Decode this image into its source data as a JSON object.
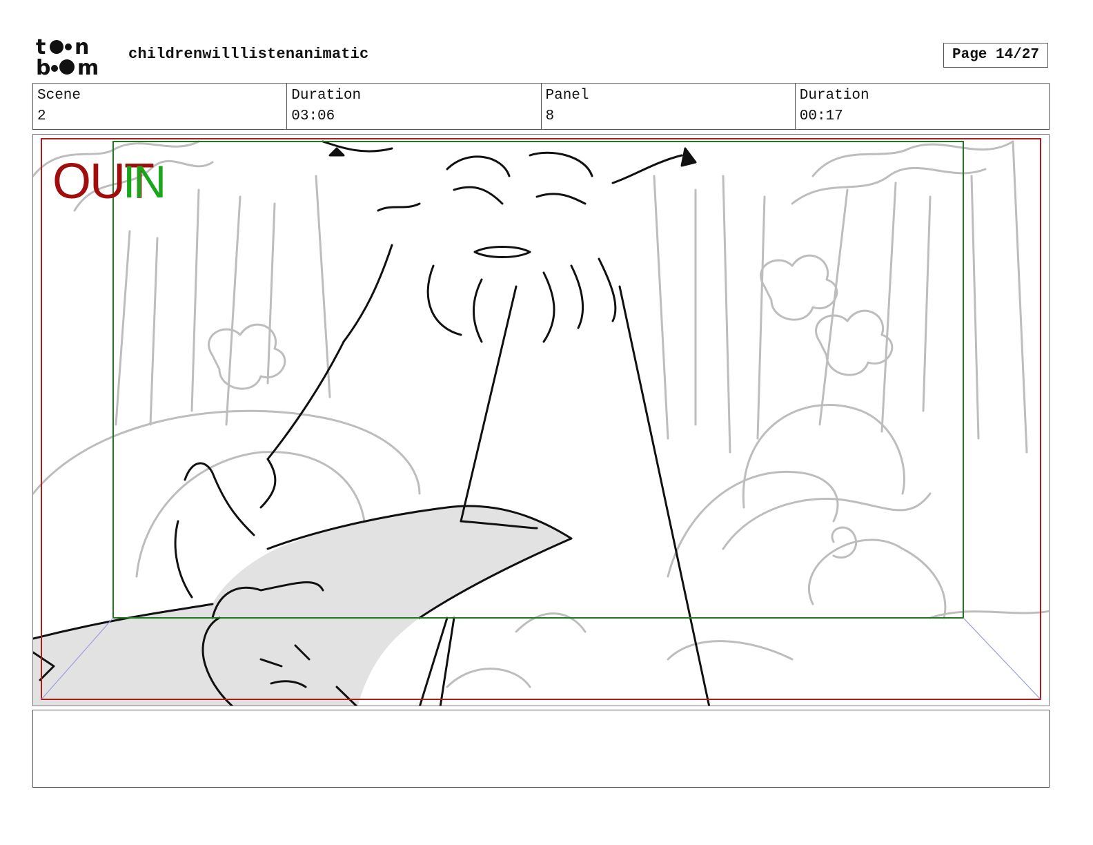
{
  "header": {
    "logo_text": "toon boom",
    "document_title": "childrenwilllistenanimatic",
    "page_label": "Page 14/27"
  },
  "info": {
    "scene_label": "Scene",
    "scene_value": "2",
    "scene_duration_label": "Duration",
    "scene_duration_value": "03:06",
    "panel_label": "Panel",
    "panel_value": "8",
    "panel_duration_label": "Duration",
    "panel_duration_value": "00:17"
  },
  "panel": {
    "out_label": "OUT",
    "in_label": "IN",
    "colors": {
      "out_frame": "#b01c1c",
      "in_frame": "#1f7a1f",
      "sketch_light": "#b8b8b8",
      "sketch_dark": "#111111",
      "fill_gray": "#e2e2e2"
    }
  },
  "notes": {
    "text": ""
  }
}
